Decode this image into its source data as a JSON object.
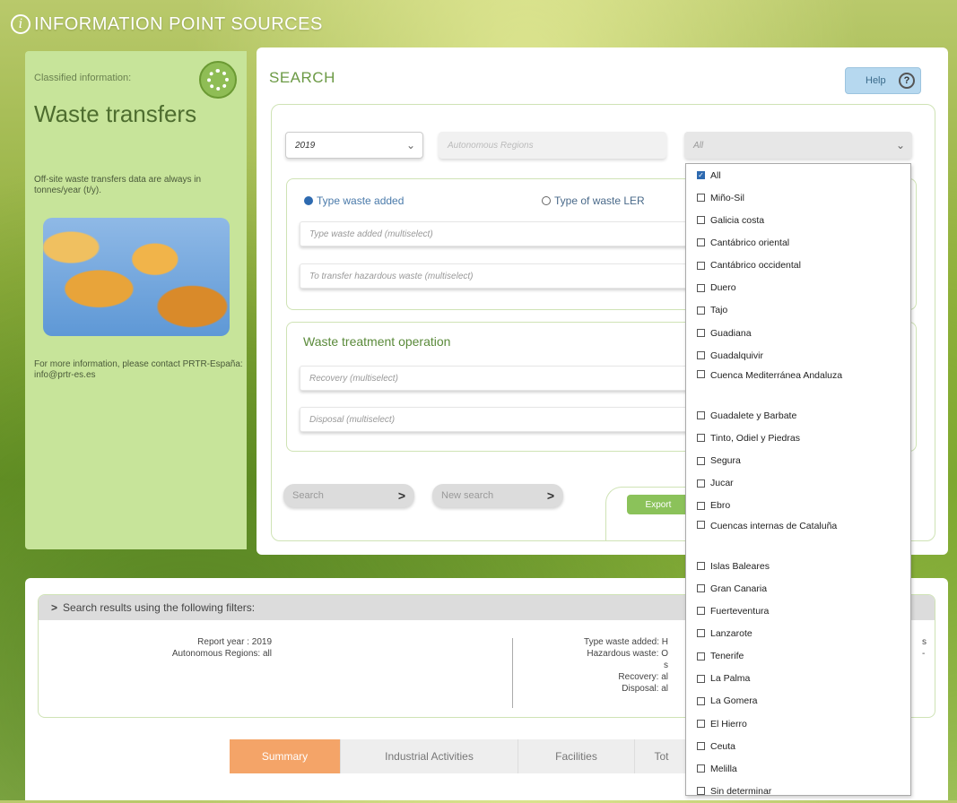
{
  "header": {
    "info_icon": "i",
    "title": "INFORMATION POINT SOURCES"
  },
  "left": {
    "classified_label": "Classified information:",
    "heading": "Waste transfers",
    "note": "Off-site waste transfers data are always in tonnes/year (t/y).",
    "contact": "For more information, please contact PRTR-España: info@prtr-es.es"
  },
  "search": {
    "title": "SEARCH",
    "help_label": "Help",
    "help_icon": "?",
    "year_value": "2019",
    "region_placeholder": "Autonomous Regions",
    "basin_value": "All",
    "radio_added": "Type waste added",
    "radio_ler": "Type of waste LER",
    "ms_added": "Type waste added (multiselect)",
    "ms_hazardous": "To transfer hazardous waste (multiselect)",
    "treatment_title": "Waste treatment operation",
    "ms_recovery": "Recovery (multiselect)",
    "ms_disposal": "Disposal (multiselect)",
    "search_btn": "Search",
    "new_search_btn": "New search",
    "export_btn": "Export",
    "arrow": ">"
  },
  "results": {
    "bar_label": "Search results using the following filters:",
    "bar_arrow": ">",
    "left_lines": [
      "Report year : 2019",
      "Autonomous Regions: all"
    ],
    "mid_lines": [
      "Type waste added: H",
      "Hazardous waste: O",
      "s",
      "Recovery: al",
      "Disposal: al"
    ],
    "right_lines": [
      "s",
      "-"
    ]
  },
  "tabs": [
    "Summary",
    "Industrial Activities",
    "Facilities",
    "Tot"
  ],
  "dropdown": {
    "options": [
      {
        "label": "All",
        "checked": true
      },
      {
        "label": "Miño-Sil",
        "checked": false
      },
      {
        "label": "Galicia costa",
        "checked": false
      },
      {
        "label": "Cantábrico oriental",
        "checked": false
      },
      {
        "label": "Cantábrico occidental",
        "checked": false
      },
      {
        "label": "Duero",
        "checked": false
      },
      {
        "label": "Tajo",
        "checked": false
      },
      {
        "label": "Guadiana",
        "checked": false
      },
      {
        "label": "Guadalquivir",
        "checked": false
      },
      {
        "label": "Cuenca Mediterránea Andaluza",
        "checked": false
      },
      {
        "label": "Guadalete y Barbate",
        "checked": false
      },
      {
        "label": "Tinto, Odiel y Piedras",
        "checked": false
      },
      {
        "label": "Segura",
        "checked": false
      },
      {
        "label": "Jucar",
        "checked": false
      },
      {
        "label": "Ebro",
        "checked": false
      },
      {
        "label": "Cuencas internas de Cataluña",
        "checked": false
      },
      {
        "label": "Islas Baleares",
        "checked": false
      },
      {
        "label": "Gran Canaria",
        "checked": false
      },
      {
        "label": "Fuerteventura",
        "checked": false
      },
      {
        "label": "Lanzarote",
        "checked": false
      },
      {
        "label": "Tenerife",
        "checked": false
      },
      {
        "label": "La Palma",
        "checked": false
      },
      {
        "label": "La Gomera",
        "checked": false
      },
      {
        "label": "El Hierro",
        "checked": false
      },
      {
        "label": "Ceuta",
        "checked": false
      },
      {
        "label": "Melilla",
        "checked": false
      },
      {
        "label": "Sin determinar",
        "checked": false
      }
    ]
  },
  "colors": {
    "accent_green": "#6c9a45",
    "tab_active": "#f4a468",
    "panel_green": "#c7e49a"
  }
}
